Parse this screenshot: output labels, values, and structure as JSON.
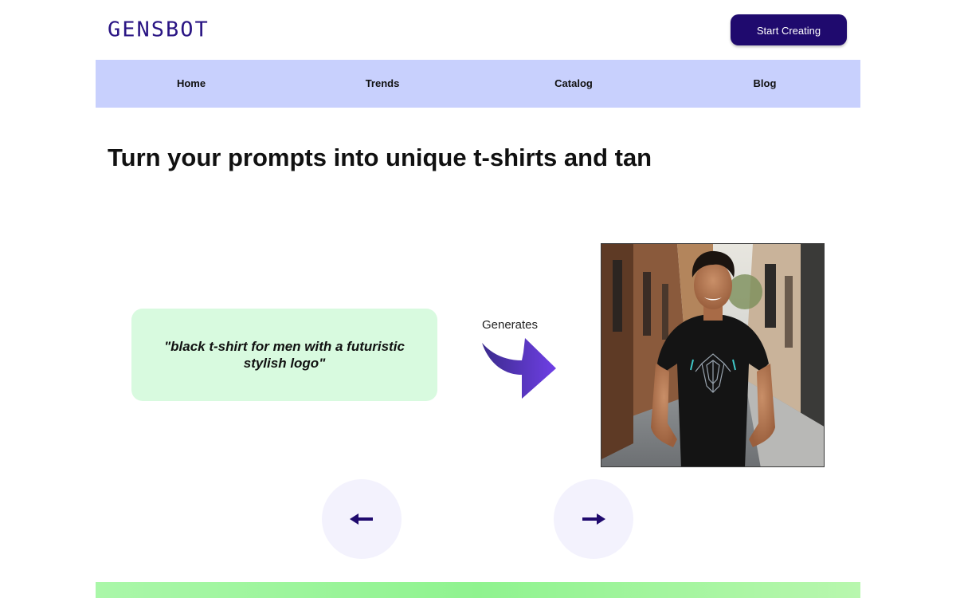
{
  "header": {
    "logo_text": "GENSBOT",
    "cta_label": "Start Creating"
  },
  "nav": {
    "items": [
      {
        "label": "Home"
      },
      {
        "label": "Trends"
      },
      {
        "label": "Catalog"
      },
      {
        "label": "Blog"
      }
    ]
  },
  "hero": {
    "headline": "Turn your prompts into unique t-shirts and tan"
  },
  "demo": {
    "prompt": "\"black t-shirt for men with a futuristic stylish logo\"",
    "generates_label": "Generates",
    "image_description": "smiling man wearing black t-shirt with futuristic logo on a street"
  },
  "carousel": {
    "prev_icon": "arrow-left-icon",
    "next_icon": "arrow-right-icon"
  },
  "colors": {
    "brand": "#2a1584",
    "cta_bg": "#1f0a6e",
    "nav_bg": "#c8d0fd",
    "prompt_bg": "#d8fadf",
    "circle_bg": "#f3f2fd",
    "footer_green": "#8ff38f"
  }
}
